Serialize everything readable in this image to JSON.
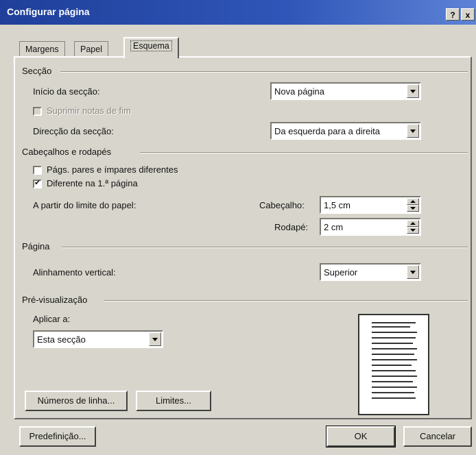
{
  "window": {
    "title": "Configurar página",
    "help_label": "?",
    "close_label": "x"
  },
  "tabs": [
    {
      "label": "Margens"
    },
    {
      "label": "Papel"
    },
    {
      "label": "Esquema",
      "active": true
    }
  ],
  "section": {
    "header": "Secção",
    "start_label": "Início da secção:",
    "start_value": "Nova página",
    "suppress_endnotes_label": "Suprimir notas de fim",
    "direction_label": "Direcção da secção:",
    "direction_value": "Da esquerda para a direita"
  },
  "headers_footers": {
    "header": "Cabeçalhos e rodapés",
    "odd_even_label": "Págs. pares e ímpares diferentes",
    "odd_even_checked": false,
    "first_page_label": "Diferente na 1.ª página",
    "first_page_checked": true,
    "from_edge_label": "A partir do limite do papel:",
    "header_label": "Cabeçalho:",
    "header_value": "1,5 cm",
    "footer_label": "Rodapé:",
    "footer_value": "2 cm"
  },
  "page": {
    "header": "Página",
    "vertical_align_label": "Alinhamento vertical:",
    "vertical_align_value": "Superior"
  },
  "preview": {
    "header": "Pré-visualização",
    "apply_to_label": "Aplicar a:",
    "apply_to_value": "Esta secção"
  },
  "buttons": {
    "line_numbers": "Números de linha...",
    "borders": "Limites...",
    "default": "Predefinição...",
    "ok": "OK",
    "cancel": "Cancelar"
  }
}
